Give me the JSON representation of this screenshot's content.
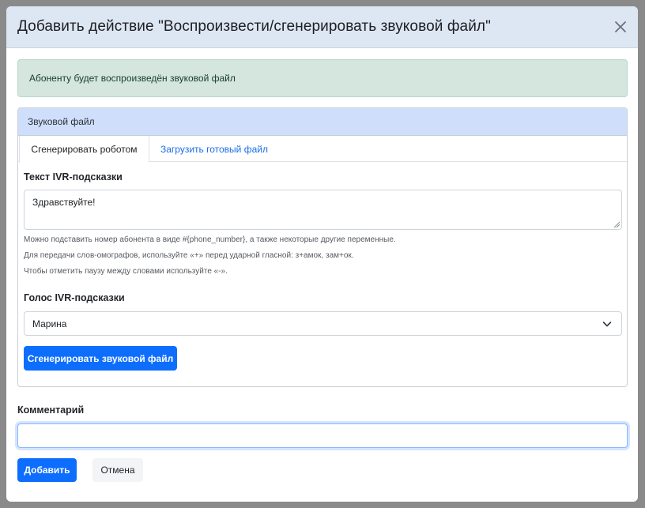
{
  "modal": {
    "title": "Добавить действие \"Воспроизвести/сгенерировать звуковой файл\""
  },
  "alert": {
    "text": "Абоненту будет воспроизведён звуковой файл"
  },
  "card": {
    "header": "Звуковой файл",
    "tabs": [
      {
        "label": "Сгенерировать роботом",
        "active": true
      },
      {
        "label": "Загрузить готовый файл",
        "active": false
      }
    ],
    "ivr_text_label": "Текст IVR-подсказки",
    "ivr_text_value": "Здравствуйте!",
    "hints": [
      "Можно подставить номер абонента в виде #{phone_number}, а также некоторые другие переменные.",
      "Для передачи слов-омографов, используйте «+» перед ударной гласной: з+амок, зам+ок.",
      "Чтобы отметить паузу между словами используйте «-»."
    ],
    "voice_label": "Голос IVR-подсказки",
    "voice_selected": "Марина",
    "generate_button": "Сгенерировать звуковой файл"
  },
  "comment": {
    "label": "Комментарий",
    "value": ""
  },
  "footer": {
    "add_button": "Добавить",
    "cancel_button": "Отмена"
  },
  "colors": {
    "primary": "#0d6efd",
    "header_bg": "#dde6f3",
    "alert_bg": "#d4e6de",
    "card_header_bg": "#cfdffb",
    "overlay": "#8a8a8a"
  },
  "icons": {
    "close": "close-icon",
    "select": "chevron-down-icon"
  }
}
